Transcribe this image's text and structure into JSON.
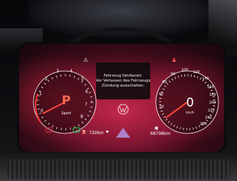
{
  "message_box": {
    "lines": [
      "Fahrzeug fahrbereit.",
      "Vor Verlassen des Fahrzeugs",
      "Zündung ausschalten."
    ]
  },
  "tachometer": {
    "ticks": [
      "1",
      "2",
      "3",
      "4",
      "5",
      "6",
      "7",
      "8"
    ],
    "gear": "P",
    "mode": "Sport",
    "zero_label": "0"
  },
  "speedometer": {
    "ticks": [
      "20",
      "40",
      "60",
      "80",
      "100",
      "120",
      "140",
      "160",
      "180",
      "200",
      "220",
      "240",
      "260"
    ],
    "value": "0",
    "unit": "km/h"
  },
  "status_bar": {
    "range": "720km",
    "odometer": "68798km"
  },
  "icons": {
    "top_left": "car-warning-icon",
    "top_right": "seatbelt-icon",
    "center": "vw-logo-icon",
    "fuel": "fuel-icon",
    "odometer": "odometer-icon",
    "battery": "battery-warning-icon",
    "engine": "engine-icon"
  },
  "colors": {
    "screen_red": "#c7284a",
    "gear_orange": "#ff6a55",
    "indicator_green": "#27c251",
    "indicator_red": "#e02a3a",
    "highlight_purple": "#b08cd8"
  }
}
